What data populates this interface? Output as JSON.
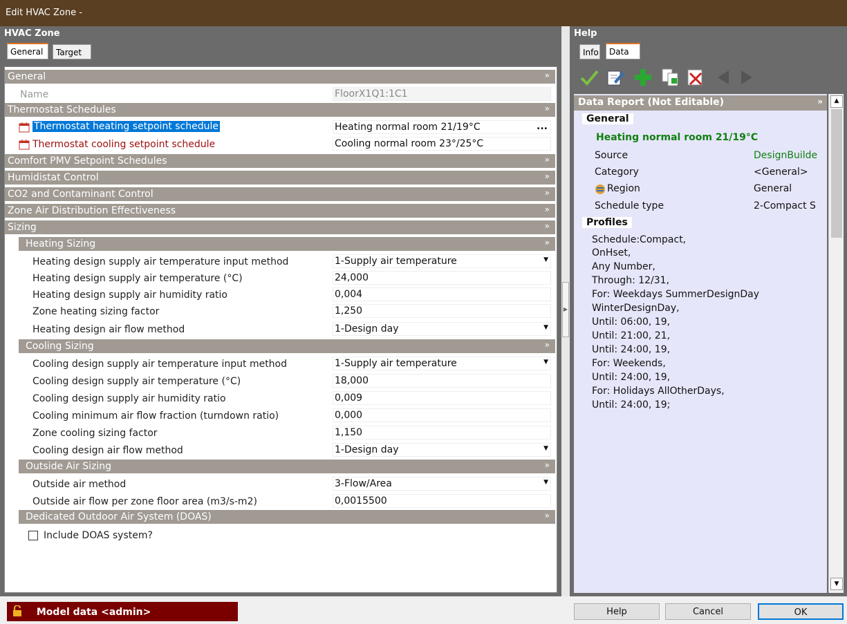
{
  "window": {
    "title": "Edit HVAC Zone -"
  },
  "left": {
    "header": "HVAC Zone",
    "tabs": [
      "General",
      "Target"
    ]
  },
  "right": {
    "header": "Help",
    "tabs": [
      "Info",
      "Data"
    ]
  },
  "sections": {
    "general": "General",
    "thermostat": "Thermostat Schedules",
    "comfort": "Comfort PMV Setpoint Schedules",
    "humidistat": "Humidistat Control",
    "co2": "CO2 and Contaminant Control",
    "zone_air": "Zone Air Distribution Effectiveness",
    "sizing": "Sizing",
    "heating_sizing": "Heating Sizing",
    "cooling_sizing": "Cooling Sizing",
    "outside_air": "Outside Air Sizing",
    "doas": "Dedicated Outdoor Air System (DOAS)"
  },
  "fields": {
    "name": {
      "label": "Name",
      "value": "FloorX1Q1:1C1"
    },
    "heat_sched": {
      "label": "Thermostat heating setpoint schedule",
      "value": "Heating normal room 21/19°C",
      "browse": "..."
    },
    "cool_sched": {
      "label": "Thermostat cooling setpoint schedule",
      "value": "Cooling normal room 23°/25°C"
    },
    "h1": {
      "label": "Heating design supply air temperature input method",
      "value": "1-Supply air temperature"
    },
    "h2": {
      "label": "Heating design supply air temperature (°C)",
      "value": "24,000"
    },
    "h3": {
      "label": "Heating design supply air humidity ratio",
      "value": "0,004"
    },
    "h4": {
      "label": "Zone heating sizing factor",
      "value": "1,250"
    },
    "h5": {
      "label": "Heating design air flow method",
      "value": "1-Design day"
    },
    "c1": {
      "label": "Cooling design supply air temperature input method",
      "value": "1-Supply air temperature"
    },
    "c2": {
      "label": "Cooling design supply air temperature (°C)",
      "value": "18,000"
    },
    "c3": {
      "label": "Cooling design supply air humidity ratio",
      "value": "0,009"
    },
    "c4": {
      "label": "Cooling minimum air flow fraction (turndown ratio)",
      "value": "0,000"
    },
    "c5": {
      "label": "Zone cooling sizing factor",
      "value": "1,150"
    },
    "c6": {
      "label": "Cooling design air flow method",
      "value": "1-Design day"
    },
    "o1": {
      "label": "Outside air method",
      "value": "3-Flow/Area"
    },
    "o2": {
      "label": "Outside air flow per zone floor area (m3/s-m2)",
      "value": "0,0015500"
    },
    "doas_check": {
      "label": "Include DOAS system?"
    }
  },
  "help": {
    "report_title": "Data Report (Not Editable)",
    "general": "General",
    "item_title": "Heating normal room 21/19°C",
    "props": [
      {
        "k": "Source",
        "v": "DesignBuilde"
      },
      {
        "k": "Category",
        "v": "<General>"
      },
      {
        "k": "Region",
        "v": "General"
      },
      {
        "k": "Schedule type",
        "v": "2-Compact S"
      }
    ],
    "profiles": "Profiles",
    "lines": [
      "Schedule:Compact,",
      "OnHset,",
      "Any Number,",
      "Through: 12/31,",
      "For: Weekdays SummerDesignDay",
      "WinterDesignDay,",
      "Until: 06:00, 19,",
      "Until: 21:00, 21,",
      "Until: 24:00, 19,",
      "For: Weekends,",
      "Until: 24:00, 19,",
      "For: Holidays AllOtherDays,",
      "Until: 24:00, 19;"
    ]
  },
  "status": {
    "model": "Model data <admin>"
  },
  "buttons": {
    "help": "Help",
    "cancel": "Cancel",
    "ok": "OK"
  },
  "colors": {
    "titlebar": "#5a3f23",
    "section": "#a09a93",
    "selection": "#0078d7",
    "status_red": "#7a0000",
    "green_title": "#108010"
  }
}
